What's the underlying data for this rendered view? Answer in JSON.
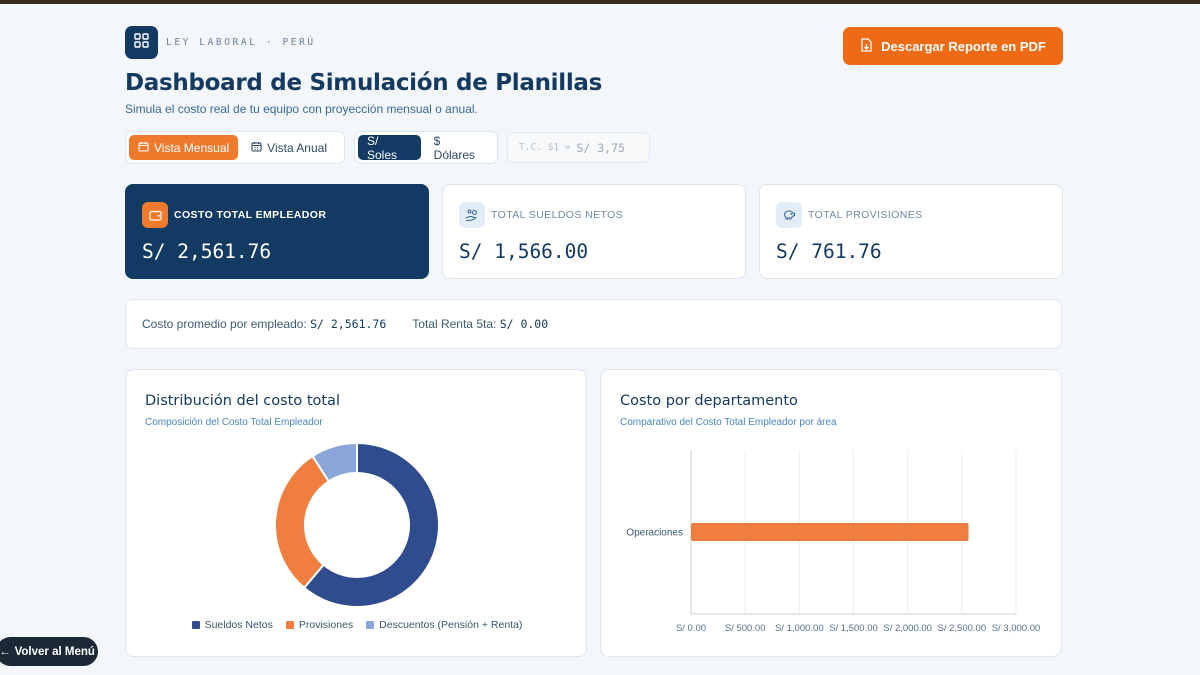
{
  "header": {
    "brand": "LEY LABORAL · PERÚ",
    "title": "Dashboard de Simulación de Planillas",
    "subtitle": "Simula el costo real de tu equipo con proyección mensual o anual.",
    "pdf_button": "Descargar Reporte en PDF"
  },
  "view_toggle": {
    "options": [
      {
        "label": "Vista Mensual",
        "icon": "calendar-icon",
        "active": true
      },
      {
        "label": "Vista Anual",
        "icon": "calendar-grid-icon",
        "active": false
      }
    ]
  },
  "currency_toggle": {
    "options": [
      {
        "label": "S/ Soles",
        "active": true
      },
      {
        "label": "$ Dólares",
        "active": false
      }
    ]
  },
  "exchange_rate": {
    "label": "T.C. $1 =",
    "value": "S/ 3,75"
  },
  "kpis": [
    {
      "label": "COSTO TOTAL EMPLEADOR",
      "value": "S/ 2,561.76",
      "icon": "wallet-icon",
      "style": "dark"
    },
    {
      "label": "TOTAL SUELDOS NETOS",
      "value": "S/ 1,566.00",
      "icon": "hand-coins-icon",
      "style": "light"
    },
    {
      "label": "TOTAL PROVISIONES",
      "value": "S/ 761.76",
      "icon": "piggy-bank-icon",
      "style": "light"
    }
  ],
  "summary": {
    "avg_label": "Costo promedio por empleado:",
    "avg_value": "S/ 2,561.76",
    "renta_label": "Total Renta 5ta:",
    "renta_value": "S/ 0.00"
  },
  "distribution": {
    "title": "Distribución del costo total",
    "subtitle": "Composición del Costo Total Empleador"
  },
  "department": {
    "title": "Costo por departamento",
    "subtitle": "Comparativo del Costo Total Empleador por área"
  },
  "back_button": "Volver al Menú",
  "colors": {
    "navy": "#123a63",
    "orange": "#ee6a14",
    "donut_navy": "#2f4c8f",
    "donut_orange": "#f07f3f",
    "donut_light": "#8aa6d8"
  },
  "chart_data": [
    {
      "type": "pie",
      "variant": "donut",
      "categories": [
        "Sueldos Netos",
        "Provisiones",
        "Descuentos (Pensión + Renta)"
      ],
      "values": [
        1566.0,
        761.76,
        234.0
      ],
      "colors": [
        "#2f4c8f",
        "#f07f3f",
        "#8aa6d8"
      ],
      "legend": "bottom"
    },
    {
      "type": "bar",
      "orientation": "horizontal",
      "categories": [
        "Operaciones"
      ],
      "values": [
        2561.76
      ],
      "xlim": [
        0,
        3000
      ],
      "xticks": [
        "S/ 0.00",
        "S/ 500.00",
        "S/ 1,000.00",
        "S/ 1,500.00",
        "S/ 2,000.00",
        "S/ 2,500.00",
        "S/ 3,000.00"
      ],
      "xtick_values": [
        0,
        500,
        1000,
        1500,
        2000,
        2500,
        3000
      ],
      "color": "#f07f3f",
      "grid": true
    }
  ]
}
